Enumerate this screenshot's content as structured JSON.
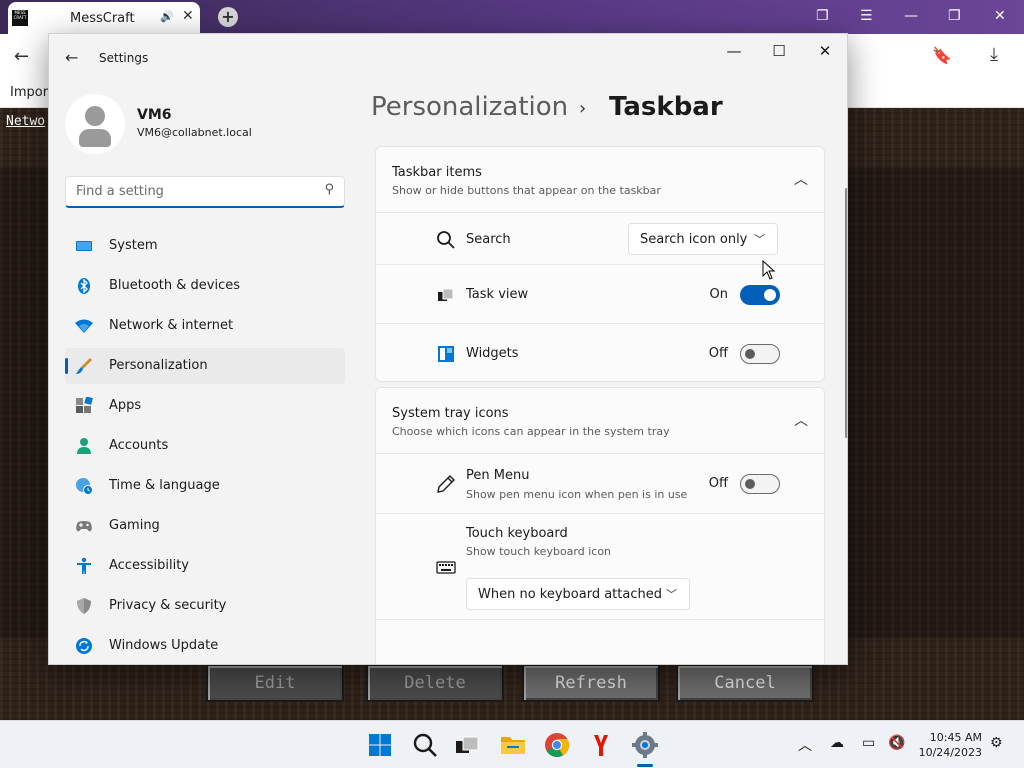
{
  "browser": {
    "tab_title": "MessCraft",
    "favicon_text": "MESS CRAFT",
    "bookmarks_text": "Import",
    "network_link": "Netwo",
    "buttons": [
      "Edit",
      "Delete",
      "Refresh",
      "Cancel"
    ]
  },
  "settings": {
    "window_title": "Settings",
    "user": {
      "name": "VM6",
      "email": "VM6@collabnet.local"
    },
    "search_placeholder": "Find a setting",
    "nav": [
      {
        "label": "System",
        "icon": "monitor-icon"
      },
      {
        "label": "Bluetooth & devices",
        "icon": "bluetooth-icon"
      },
      {
        "label": "Network & internet",
        "icon": "wifi-icon"
      },
      {
        "label": "Personalization",
        "icon": "brush-icon",
        "active": true
      },
      {
        "label": "Apps",
        "icon": "apps-icon"
      },
      {
        "label": "Accounts",
        "icon": "person-icon"
      },
      {
        "label": "Time & language",
        "icon": "globe-clock-icon"
      },
      {
        "label": "Gaming",
        "icon": "gamepad-icon"
      },
      {
        "label": "Accessibility",
        "icon": "accessibility-icon"
      },
      {
        "label": "Privacy & security",
        "icon": "shield-icon"
      },
      {
        "label": "Windows Update",
        "icon": "update-icon"
      }
    ],
    "breadcrumb": {
      "parent": "Personalization",
      "current": "Taskbar"
    },
    "taskbar_items": {
      "title": "Taskbar items",
      "subtitle": "Show or hide buttons that appear on the taskbar",
      "search": {
        "label": "Search",
        "value": "Search icon only"
      },
      "task_view": {
        "label": "Task view",
        "state": "On"
      },
      "widgets": {
        "label": "Widgets",
        "state": "Off"
      }
    },
    "system_tray": {
      "title": "System tray icons",
      "subtitle": "Choose which icons can appear in the system tray",
      "pen_menu": {
        "label": "Pen Menu",
        "sub": "Show pen menu icon when pen is in use",
        "state": "Off"
      },
      "touch_keyboard": {
        "label": "Touch keyboard",
        "sub": "Show touch keyboard icon",
        "value": "When no keyboard attached"
      }
    }
  },
  "taskbar": {
    "time": "10:45 AM",
    "date": "10/24/2023"
  },
  "colors": {
    "accent": "#005fb8"
  }
}
